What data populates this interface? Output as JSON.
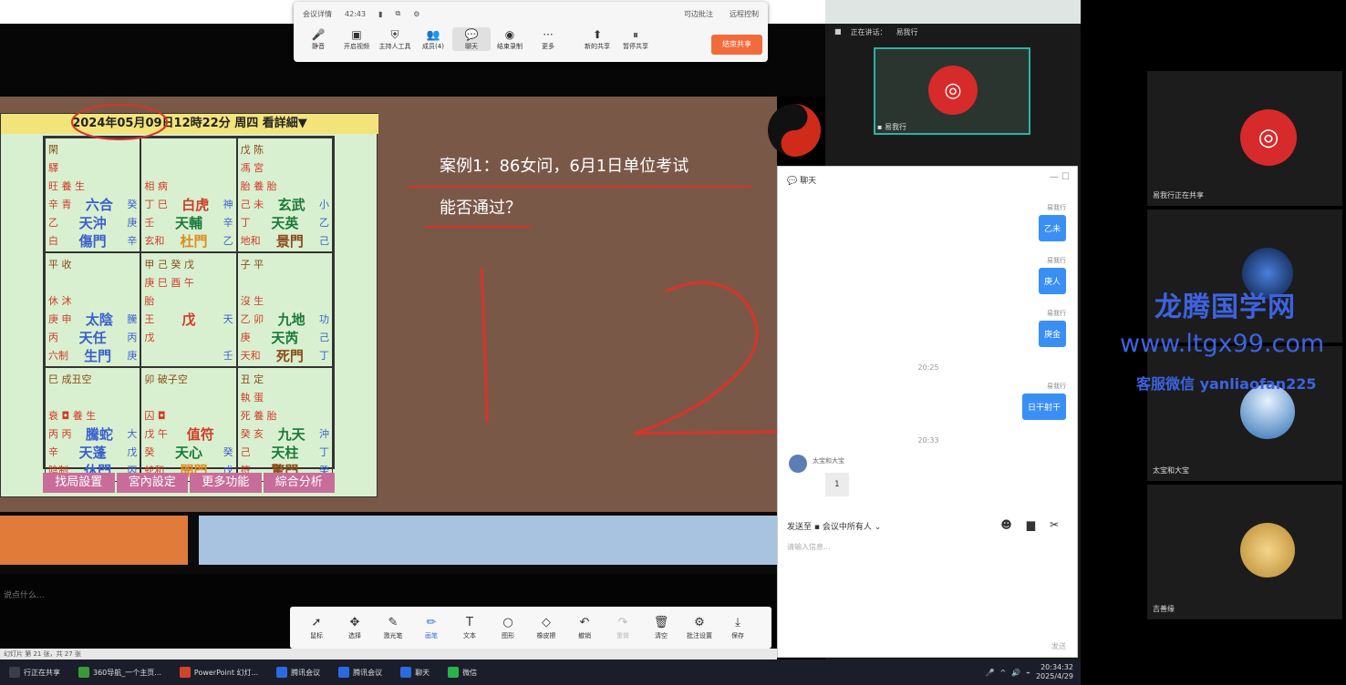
{
  "meeting_toolbar": {
    "info_left": "会议详情",
    "timer": "42:43",
    "info_right1": "可边批注",
    "info_right2": "远程控制",
    "buttons": [
      {
        "label": "静音",
        "icon": "mic-icon"
      },
      {
        "label": "开启视频",
        "icon": "video-icon"
      },
      {
        "label": "主持人工具",
        "icon": "shield-icon"
      },
      {
        "label": "成员(4)",
        "icon": "members-icon"
      },
      {
        "label": "聊天",
        "icon": "chat-icon"
      },
      {
        "label": "结束录制",
        "icon": "record-icon"
      },
      {
        "label": "更多",
        "icon": "more-icon"
      },
      {
        "label": "新的共享",
        "icon": "share-icon"
      },
      {
        "label": "暂停共享",
        "icon": "pause-icon"
      }
    ],
    "end_share": "结束共享"
  },
  "board": {
    "header": "2024年05月09日12時22分 周四 看詳細▼",
    "bottom_buttons": [
      "找局設置",
      "宮內設定",
      "更多功能",
      "綜合分析"
    ],
    "cells": [
      {
        "l1": "閑",
        "l2": "驛",
        "l3": "旺 養 生",
        "l4a": "辛 青",
        "l4b": "六合",
        "l4c": "癸",
        "l5a": "乙",
        "l5b": "天沖",
        "l5c": "庚",
        "l6a": "白",
        "l6b": "傷門",
        "l6c": "辛"
      },
      {
        "l1": "",
        "l2": "",
        "l3": "相 病",
        "l4a": "丁 巳",
        "l4b": "白虎",
        "l4c": "神",
        "l5a": "壬",
        "l5b": "天輔",
        "l5c": "辛",
        "l6a": "玄和",
        "l6b": "杜門",
        "l6c": "乙"
      },
      {
        "l1": "戊 陈",
        "l2": "馮 宮",
        "l3": "胎 養 胎",
        "l4a": "己 未",
        "l4b": "玄武",
        "l4c": "小",
        "l5a": "丁",
        "l5b": "天英",
        "l5c": "乙",
        "l6a": "地和",
        "l6b": "景門",
        "l6c": "己"
      },
      {
        "l1": "平 收",
        "l2": "",
        "l3": "休 沐",
        "l4a": "庚 申",
        "l4b": "太陰",
        "l4c": "騰",
        "l5a": "丙",
        "l5b": "天任",
        "l5c": "丙",
        "l6a": "六制",
        "l6b": "生門",
        "l6c": "庚"
      },
      {
        "l1": "甲 己 癸 戊",
        "l2": "庚 巳 酉 午",
        "l3": "胎",
        "l4a": "王",
        "l4b": "戊",
        "l4c": "天",
        "l5a": "戊",
        "l5b": "",
        "l5c": "",
        "l6a": "",
        "l6b": "",
        "l6c": "壬"
      },
      {
        "l1": "子 平",
        "l2": "",
        "l3": "沒 生",
        "l4a": "乙 卯",
        "l4b": "九地",
        "l4c": "功",
        "l5a": "庚",
        "l5b": "天芮",
        "l5c": "己",
        "l6a": "天和",
        "l6b": "死門",
        "l6c": "丁"
      },
      {
        "l1": "巳 成丑空",
        "l2": "",
        "l3": "衰 ◘ 養 生",
        "l4a": "丙 丙",
        "l4b": "騰蛇",
        "l4c": "大",
        "l5a": "辛",
        "l5b": "天蓬",
        "l5c": "戊",
        "l6a": "陰制",
        "l6b": "休門",
        "l6c": "丙"
      },
      {
        "l1": "卯 破子空",
        "l2": "",
        "l3": "囚 ◘",
        "l4a": "戊 午",
        "l4b": "值符",
        "l4c": "",
        "l5a": "癸",
        "l5b": "天心",
        "l5c": "癸",
        "l6a": "蛇和",
        "l6b": "開門",
        "l6c": "戊"
      },
      {
        "l1": "丑 定",
        "l2": "執 蛋",
        "l3": "死 養 胎",
        "l4a": "癸 亥",
        "l4b": "九天",
        "l4c": "沖",
        "l5a": "己",
        "l5b": "天柱",
        "l5c": "丁",
        "l6a": "符",
        "l6b": "驚門",
        "l6c": "癸"
      }
    ]
  },
  "slide": {
    "case_line1": "案例1：86女问，6月1日单位考试",
    "case_line2": "能否通过？",
    "placeholder": "说点什么..."
  },
  "panel": {
    "speaking": "正在讲话：",
    "speaker": "易我行",
    "main_name": "易我行"
  },
  "chat": {
    "title": "聊天",
    "messages": [
      {
        "name": "易我行",
        "text": "乙未"
      },
      {
        "name": "易我行",
        "text": "庚人"
      },
      {
        "name": "易我行",
        "text": "庚金"
      },
      {
        "name": "易我行",
        "text": "日干射干"
      }
    ],
    "time1": "20:25",
    "time2": "20:33",
    "left_name": "太宝和大宝",
    "left_text": "1",
    "send_to_label": "发送至",
    "send_to_target": "会议中所有人",
    "input_placeholder": "请输入信息...",
    "send_label": "发送"
  },
  "annotation_toolbar": [
    {
      "label": "鼠标",
      "icon": "cursor-icon"
    },
    {
      "label": "选择",
      "icon": "move-icon"
    },
    {
      "label": "激光笔",
      "icon": "laser-icon"
    },
    {
      "label": "画笔",
      "icon": "pen-icon"
    },
    {
      "label": "文本",
      "icon": "text-icon"
    },
    {
      "label": "图形",
      "icon": "shape-icon"
    },
    {
      "label": "橡皮擦",
      "icon": "eraser-icon"
    },
    {
      "label": "撤销",
      "icon": "undo-icon"
    },
    {
      "label": "重做",
      "icon": "redo-icon"
    },
    {
      "label": "清空",
      "icon": "trash-icon"
    },
    {
      "label": "批注设置",
      "icon": "gear-icon"
    },
    {
      "label": "保存",
      "icon": "save-icon"
    }
  ],
  "status_bar": "幻灯片 第 21 张，共 27 张",
  "taskbar": {
    "items": [
      {
        "label": "行正在共享",
        "color": "#3a3d4a"
      },
      {
        "label": "360导航_一个主页...",
        "color": "#3a9a3a"
      },
      {
        "label": "PowerPoint 幻灯...",
        "color": "#d0452a"
      },
      {
        "label": "腾讯会议",
        "color": "#2a6ae0"
      },
      {
        "label": "腾讯会议",
        "color": "#2a6ae0"
      },
      {
        "label": "聊天",
        "color": "#2a6ae0"
      },
      {
        "label": "微信",
        "color": "#2ab34a"
      }
    ],
    "time": "20:34:32",
    "date": "2025/4/29"
  },
  "participants": [
    {
      "name": "易我行正在共享"
    },
    {
      "name": ""
    },
    {
      "name": "太宝和大宝"
    },
    {
      "name": "吉善缘"
    }
  ],
  "watermark": {
    "line1": "龙腾国学网",
    "line2": "www.ltgx99.com",
    "line3": "客服微信 yanliaofan225"
  }
}
